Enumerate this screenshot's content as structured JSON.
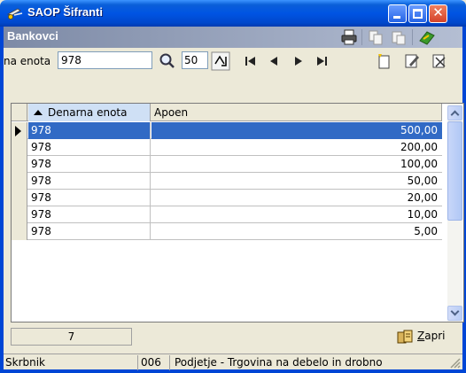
{
  "window": {
    "title": "SAOP Šifranti",
    "icon": "scissors-icon"
  },
  "subheader": {
    "title": "Bankovci",
    "icons": [
      "printer-icon",
      "copy-icon",
      "paste-icon",
      "exit-icon"
    ]
  },
  "toolbar": {
    "filter_label": "na enota",
    "filter_value": "978",
    "page_size": "50",
    "icons": [
      "search-icon",
      "sort-icon",
      "first-record-icon",
      "prev-record-icon",
      "next-record-icon",
      "last-record-icon",
      "new-record-icon",
      "edit-record-icon",
      "delete-record-icon"
    ]
  },
  "grid": {
    "columns": [
      "Denarna enota",
      "Apoen"
    ],
    "rows": [
      {
        "currency": "978",
        "value": "500,00",
        "selected": true
      },
      {
        "currency": "978",
        "value": "200,00",
        "selected": false
      },
      {
        "currency": "978",
        "value": "100,00",
        "selected": false
      },
      {
        "currency": "978",
        "value": "50,00",
        "selected": false
      },
      {
        "currency": "978",
        "value": "20,00",
        "selected": false
      },
      {
        "currency": "978",
        "value": "10,00",
        "selected": false
      },
      {
        "currency": "978",
        "value": "5,00",
        "selected": false
      }
    ]
  },
  "footer": {
    "record_count": "7",
    "close_label_prefix": "Z",
    "close_label_rest": "apri"
  },
  "statusbar": {
    "user": "Skrbnik",
    "company_code": "006",
    "company_name": "Podjetje - Trgovina na debelo in drobno"
  },
  "colors": {
    "title_blue": "#0054e3",
    "selection": "#316ac5",
    "header_sort": "#cfe0f5"
  }
}
